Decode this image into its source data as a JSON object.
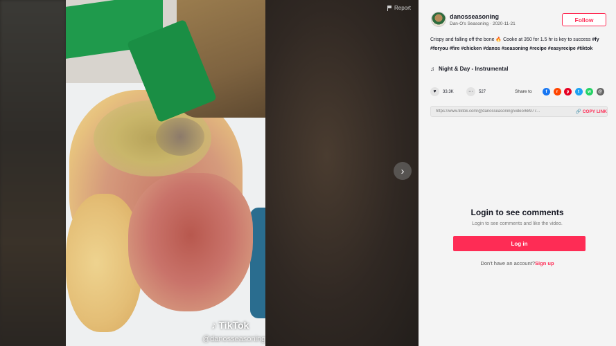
{
  "player": {
    "report_label": "Report",
    "watermark_brand": "TikTok",
    "watermark_handle": "@danosseasoning",
    "next_icon": "chevron-right-icon"
  },
  "author": {
    "username": "danosseasoning",
    "nickname": "Dan-O's Seasoning",
    "date": "2020-11-21",
    "follow_label": "Follow"
  },
  "description": {
    "text": "Crispy and falling off the bone 🔥 Cooke at 350 for 1.5 hr is key to success",
    "hashtags": [
      "#fy",
      "#foryou",
      "#fire",
      "#chicken",
      "#danos",
      "#seasoning",
      "#recipe",
      "#easyrecipe",
      "#tiktok"
    ]
  },
  "music": {
    "title": "Night & Day - Instrumental"
  },
  "stats": {
    "likes": "33.3K",
    "comments": "527",
    "share_label": "Share to"
  },
  "share_targets": [
    {
      "name": "facebook",
      "color": "#1877f2",
      "glyph": "f"
    },
    {
      "name": "reddit",
      "color": "#ff4500",
      "glyph": "r"
    },
    {
      "name": "pinterest",
      "color": "#e60023",
      "glyph": "p"
    },
    {
      "name": "twitter",
      "color": "#1da1f2",
      "glyph": "t"
    },
    {
      "name": "whatsapp",
      "color": "#25d366",
      "glyph": "w"
    },
    {
      "name": "email",
      "color": "#666666",
      "glyph": "@"
    }
  ],
  "link": {
    "url": "https://www.tiktok.com/@danosseasoning/video/68977...",
    "copy_label": "COPY LINK"
  },
  "comments": {
    "title": "Login to see comments",
    "subtitle": "Login to see comments and like the video.",
    "login_label": "Log in",
    "no_account_text": "Don't have an account?",
    "signup_label": "Sign up"
  },
  "colors": {
    "accent": "#fe2c55",
    "panel_bg": "#f4f4f4"
  }
}
